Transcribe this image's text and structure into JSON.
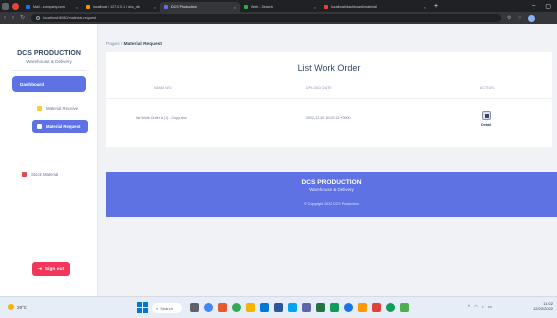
{
  "browser": {
    "tabs": [
      {
        "label": "Mail - company.com",
        "color": "#1a73e8",
        "active": false
      },
      {
        "label": "localhost / 127.0.0.1 / dcs_db",
        "color": "#f29900",
        "active": false
      },
      {
        "label": "DCS Production",
        "color": "#5e72e4",
        "active": true
      },
      {
        "label": "Web - Search",
        "color": "#34a853",
        "active": false
      },
      {
        "label": "localhost/dashboard/material",
        "color": "#ea4335",
        "active": false
      }
    ],
    "url": "localhost:8080/material-request"
  },
  "sidebar": {
    "brand": "DCS PRODUCTION",
    "brand_sub": "Warehouse & Delivery",
    "dashboard": "Dashboard",
    "items": [
      {
        "label": "Material Receive"
      },
      {
        "label": "Material Request"
      }
    ],
    "stock": "Stock Material",
    "signout": "Sign out"
  },
  "main": {
    "breadcrumb_root": "Pages",
    "breadcrumb_current": "Material Request",
    "title": "List Work Order",
    "columns": [
      "NAMA WO",
      "UPLOAD DATE",
      "ACTION"
    ],
    "rows": [
      {
        "name": "list Work Order A (1) - Copy.xlsx",
        "date": "2022-12-20 10:02:13 +0000",
        "action": "Detail"
      }
    ]
  },
  "footer": {
    "title": "DCS PRODUCTION",
    "subtitle": "Warehouse & Delivery",
    "copyright": "© Copyright 2022 DCS Production"
  },
  "taskbar": {
    "weather": "29°C",
    "search": "Search",
    "clock_time": "11:02",
    "clock_date": "12/20/2022"
  }
}
